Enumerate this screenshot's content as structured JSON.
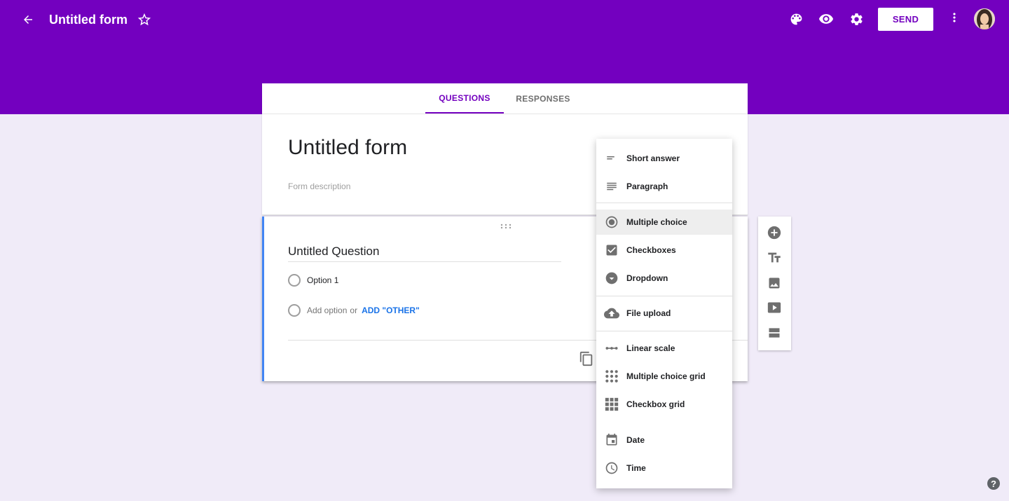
{
  "header": {
    "title": "Untitled form",
    "send_label": "SEND",
    "icons": [
      "back-arrow-icon",
      "star-icon",
      "palette-icon",
      "preview-eye-icon",
      "settings-gear-icon",
      "more-vert-icon"
    ],
    "brand_color": "#7300bf"
  },
  "tabs": [
    {
      "label": "QUESTIONS",
      "active": true
    },
    {
      "label": "RESPONSES",
      "active": false
    }
  ],
  "form": {
    "title": "Untitled form",
    "description_placeholder": "Form description"
  },
  "question": {
    "title": "Untitled Question",
    "options": [
      "Option 1"
    ],
    "add_option": "Add option",
    "or": "or",
    "add_other": "ADD \"OTHER\""
  },
  "question_type_menu": {
    "items": [
      {
        "label": "Short answer",
        "icon": "short-answer-icon"
      },
      {
        "label": "Paragraph",
        "icon": "paragraph-icon"
      },
      {
        "label": "Multiple choice",
        "icon": "radio-button-icon",
        "selected": true
      },
      {
        "label": "Checkboxes",
        "icon": "checkbox-icon"
      },
      {
        "label": "Dropdown",
        "icon": "dropdown-icon"
      },
      {
        "label": "File upload",
        "icon": "cloud-upload-icon"
      },
      {
        "label": "Linear scale",
        "icon": "linear-scale-icon"
      },
      {
        "label": "Multiple choice grid",
        "icon": "dot-grid-icon"
      },
      {
        "label": "Checkbox grid",
        "icon": "square-grid-icon"
      },
      {
        "label": "Date",
        "icon": "calendar-icon"
      },
      {
        "label": "Time",
        "icon": "clock-icon"
      }
    ]
  },
  "side_toolbar": {
    "icons": [
      "add-question-icon",
      "add-title-icon",
      "add-image-icon",
      "add-video-icon",
      "add-section-icon"
    ]
  },
  "help": {
    "label": "?"
  }
}
